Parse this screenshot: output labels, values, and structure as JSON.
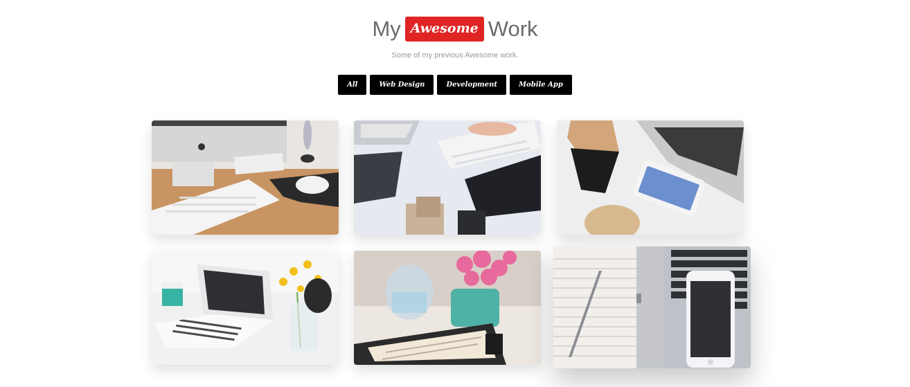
{
  "header": {
    "title_pre": "My",
    "title_badge": "Awesome",
    "title_post": "Work",
    "subtitle": "Some of my previous Awesome work.",
    "accent_color": "#e02424"
  },
  "filters": [
    {
      "label": "All"
    },
    {
      "label": "Web Design"
    },
    {
      "label": "Development"
    },
    {
      "label": "Mobile App"
    }
  ],
  "portfolio": [
    {
      "name": "imac-keyboard-mouse-desk"
    },
    {
      "name": "typing-on-keyboard-laptop"
    },
    {
      "name": "laptop-phone-coffee"
    },
    {
      "name": "white-laptop-flowers"
    },
    {
      "name": "flowers-jar-planner"
    },
    {
      "name": "notebook-pen-iphone-macbook"
    }
  ]
}
